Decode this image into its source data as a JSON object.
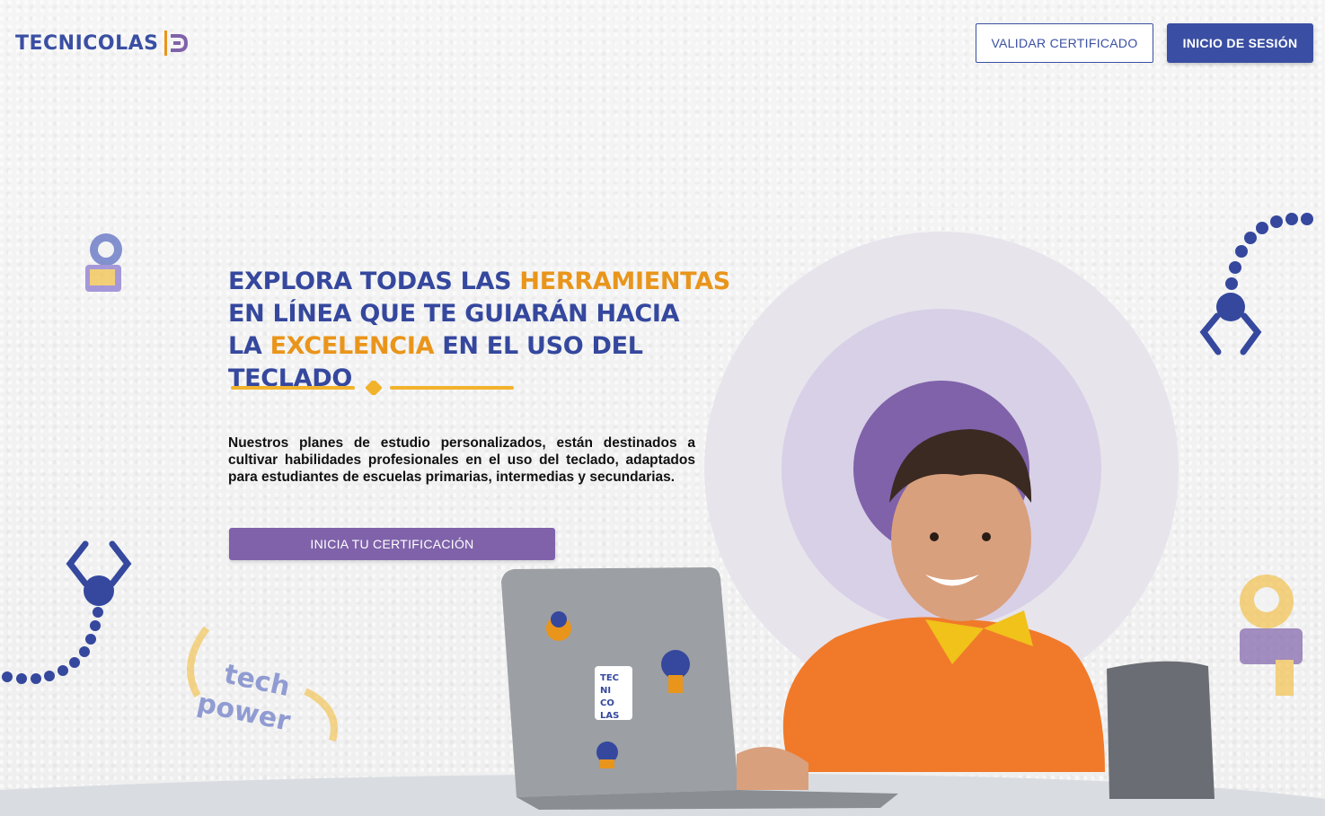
{
  "header": {
    "logo_text": "TECNICOLAS",
    "validate_label": "VALIDAR CERTIFICADO",
    "login_label": "INICIO DE SESIÓN"
  },
  "hero": {
    "headline": {
      "line1_a": "EXPLORA TODAS LAS ",
      "line1_b": "HERRAMIENTAS",
      "line2": "EN LÍNEA QUE TE GUIARÁN HACIA",
      "line3_a": "LA ",
      "line3_b": "EXCELENCIA",
      "line3_c": " EN EL USO DEL TECLADO"
    },
    "description": "Nuestros planes de estudio personalizados, están destinados a cultivar habilidades profesionales en el uso del teclado, adaptados para estudiantes de escuelas primarias, intermedias y secundarias.",
    "cta_label": "INICIA TU CERTIFICACIÓN"
  },
  "decor": {
    "sticker_text": "tech power"
  },
  "colors": {
    "brand_blue": "#35489e",
    "accent_orange": "#e9951b",
    "purple": "#7f62aa",
    "light_purple": "#d8d0e6"
  }
}
